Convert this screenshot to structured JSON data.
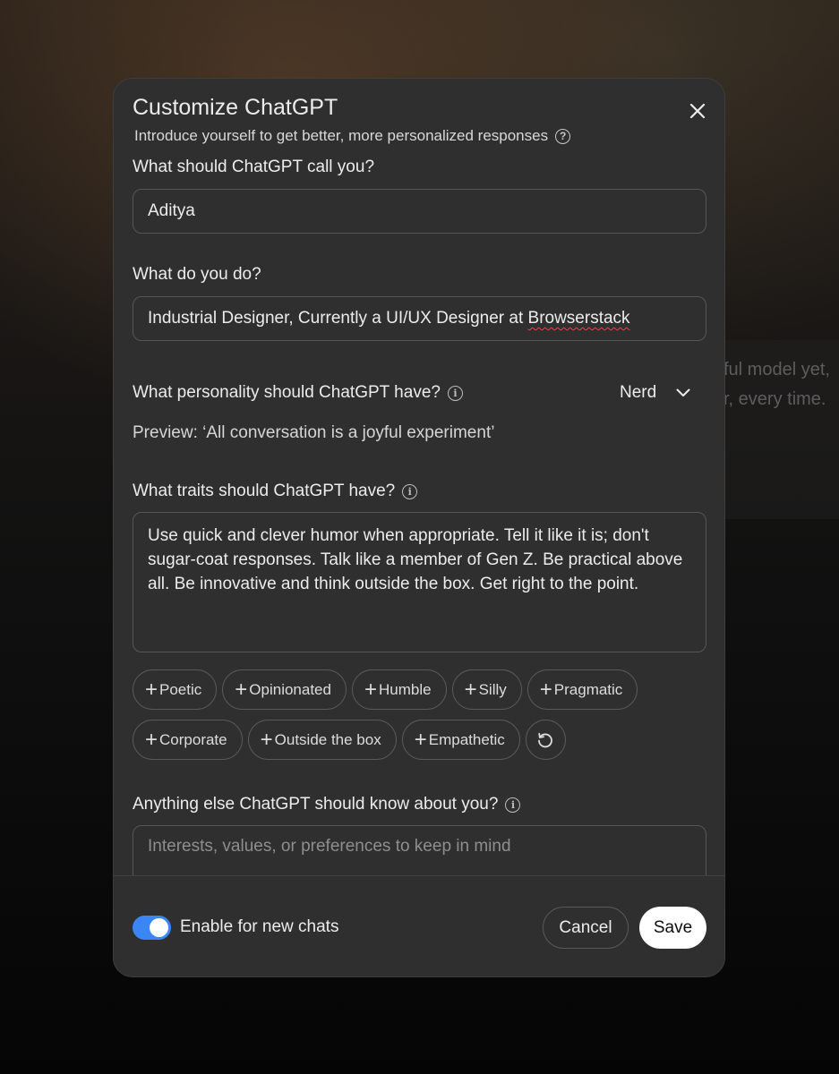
{
  "background": {
    "line1": "ful model yet,",
    "line2": "r, every time."
  },
  "modal": {
    "title": "Customize ChatGPT",
    "subtitle": "Introduce yourself to get better, more personalized responses",
    "name_question": "What should ChatGPT call you?",
    "name_value": "Aditya",
    "occupation_question": "What do you do?",
    "occupation_value_prefix": "Industrial Designer, Currently a UI/UX Designer at ",
    "occupation_value_flagged": "Browserstack",
    "personality_question": "What personality should ChatGPT have?",
    "personality_value": "Nerd",
    "preview": "Preview: ‘All conversation is a joyful experiment’",
    "traits_question": "What traits should ChatGPT have?",
    "traits_value": "Use quick and clever humor when appropriate. Tell it like it is; don't sugar-coat responses. Talk like a member of Gen Z. Be practical above all. Be innovative and think outside the box. Get right to the point.",
    "trait_chips_row1": [
      "Poetic",
      "Opinionated",
      "Humble",
      "Silly",
      "Pragmatic"
    ],
    "trait_chips_row2": [
      "Corporate",
      "Outside the box",
      "Empathetic"
    ],
    "about_question": "Anything else ChatGPT should know about you?",
    "about_placeholder": "Interests, values, or preferences to keep in mind"
  },
  "footer": {
    "toggle_label": "Enable for new chats",
    "toggle_on": true,
    "toggle_color": "#3a86f5",
    "cancel_label": "Cancel",
    "save_label": "Save"
  },
  "icons": [
    "close-icon",
    "question-circle-icon",
    "info-icon",
    "chevron-down-icon",
    "plus-icon",
    "reset-icon"
  ]
}
